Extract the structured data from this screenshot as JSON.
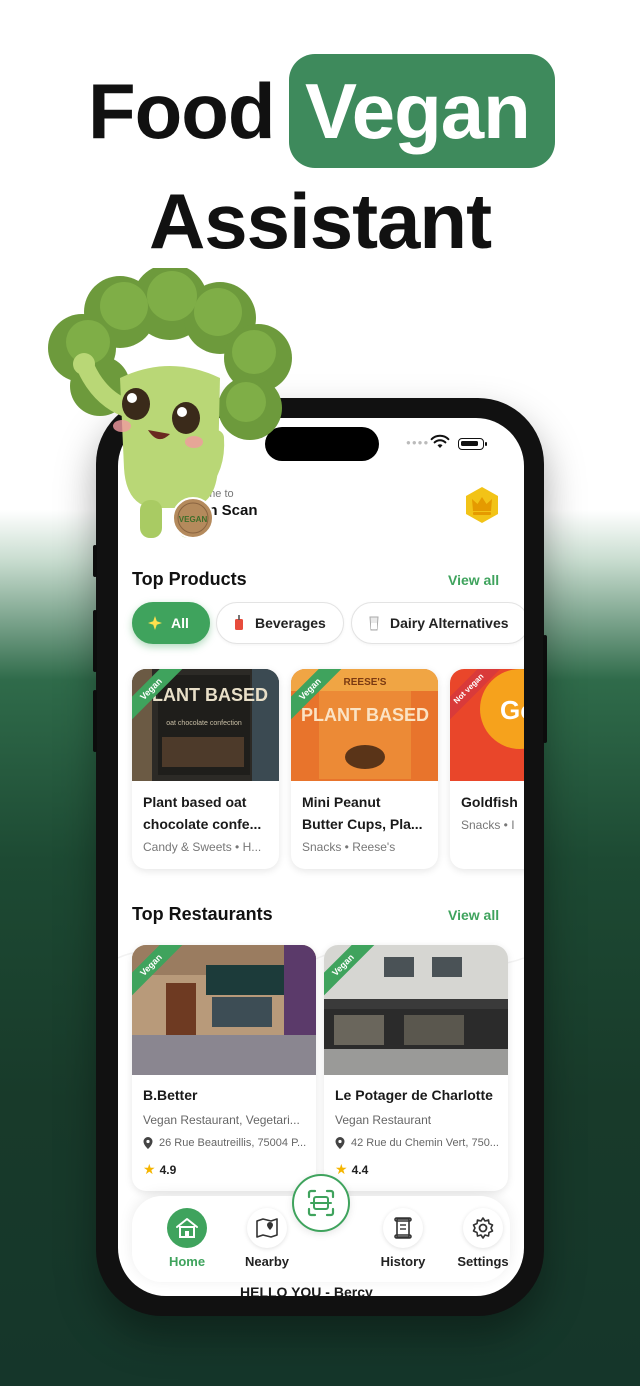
{
  "headline": {
    "word1": "Food",
    "word2": "Vegan",
    "word3": "Assistant"
  },
  "colors": {
    "brand_green": "#3e8a5c",
    "accent_green": "#3fa35d",
    "not_vegan_red": "#d93a3a",
    "star": "#f5b500"
  },
  "app": {
    "welcome_small": "ome to",
    "welcome_title": "an Scan",
    "premium_icon": "crown-icon"
  },
  "products": {
    "title": "Top Products",
    "view_all": "View all",
    "filters": [
      {
        "label": "All",
        "icon": "sparkle-icon",
        "active": true
      },
      {
        "label": "Beverages",
        "icon": "drink-icon",
        "active": false
      },
      {
        "label": "Dairy Alternatives",
        "icon": "milk-icon",
        "active": false
      }
    ],
    "items": [
      {
        "badge": "Vegan",
        "name_line1": "Plant based oat",
        "name_line2": "chocolate confe...",
        "meta": "Candy & Sweets • H...",
        "image_text": "PLANT BASED"
      },
      {
        "badge": "Vegan",
        "name_line1": "Mini Peanut",
        "name_line2": "Butter Cups, Pla...",
        "meta": "Snacks • Reese's",
        "image_text": "PLANT BASED"
      },
      {
        "badge": "Not vegan",
        "name_line1": "Goldfish",
        "name_line2": "",
        "meta": "Snacks • I",
        "image_text": "Gol"
      }
    ]
  },
  "restaurants": {
    "title": "Top Restaurants",
    "view_all": "View all",
    "items": [
      {
        "badge": "Vegan",
        "name": "B.Better",
        "type": "Vegan Restaurant, Vegetari...",
        "address": "26 Rue Beautreillis, 75004 P...",
        "rating": "4.9"
      },
      {
        "badge": "Vegan",
        "name": "Le Potager de Charlotte",
        "type": "Vegan Restaurant",
        "address": "42 Rue du Chemin Vert, 750...",
        "rating": "4.4"
      }
    ],
    "peek_name": "HELLO YOU - Bercy"
  },
  "nav": {
    "scan_icon": "scan-icon",
    "items": [
      {
        "label": "Home",
        "icon": "home-icon",
        "active": true
      },
      {
        "label": "Nearby",
        "icon": "map-icon",
        "active": false
      },
      {
        "label": "History",
        "icon": "scroll-icon",
        "active": false
      },
      {
        "label": "Settings",
        "icon": "gear-icon",
        "active": false
      }
    ]
  },
  "mascot": {
    "badge_text": "VEGAN"
  }
}
